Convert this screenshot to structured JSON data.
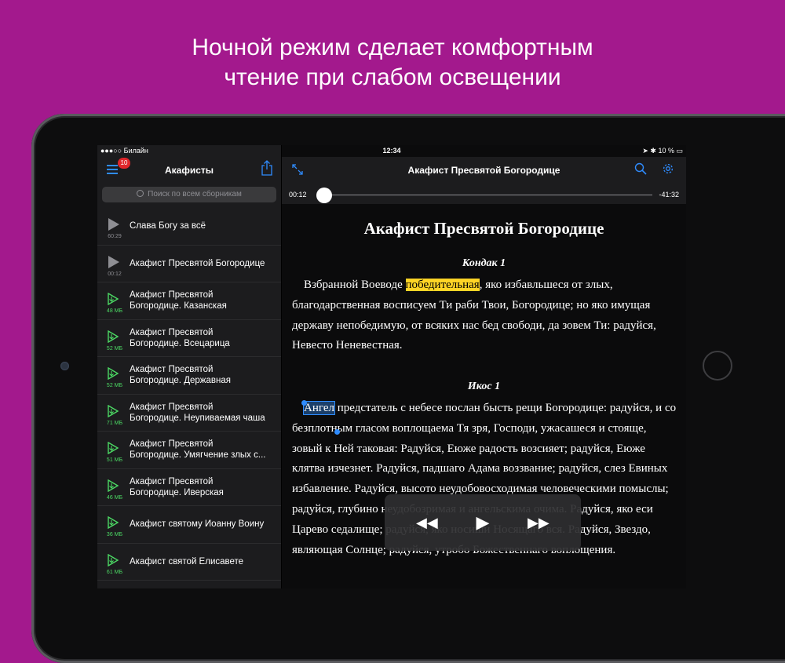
{
  "headline": {
    "line1": "Ночной режим сделает комфортным",
    "line2": "чтение при слабом освещении"
  },
  "colors": {
    "background": "#a3198d",
    "accent": "#2f8cff",
    "highlight": "#ffd426",
    "downloaded_green": "#4cd964",
    "badge_red": "#e0262b"
  },
  "status_bar": {
    "carrier": "●●●○○ Билайн",
    "time": "12:34",
    "battery": "10 %"
  },
  "sidebar": {
    "title": "Акафисты",
    "badge": "10",
    "search_placeholder": "Поиск по всем сборникам",
    "items": [
      {
        "title": "Слава Богу за всё",
        "meta": "60:29",
        "icon": "play-gray-icon"
      },
      {
        "title": "Акафист Пресвятой Богородице",
        "meta": "00:12",
        "icon": "play-gray-icon"
      },
      {
        "title": "Акафист Пресвятой\nБогородице. Казанская",
        "meta": "48 МБ",
        "icon": "download-play-green-icon"
      },
      {
        "title": "Акафист Пресвятой\nБогородице. Всецарица",
        "meta": "52 МБ",
        "icon": "download-play-green-icon"
      },
      {
        "title": "Акафист Пресвятой\nБогородице. Державная",
        "meta": "52 МБ",
        "icon": "download-play-green-icon"
      },
      {
        "title": "Акафист Пресвятой\nБогородице. Неупиваемая чаша",
        "meta": "71 МБ",
        "icon": "download-play-green-icon"
      },
      {
        "title": "Акафист Пресвятой\nБогородице. Умягчение злых с...",
        "meta": "51 МБ",
        "icon": "download-play-green-icon"
      },
      {
        "title": "Акафист Пресвятой\nБогородице. Иверская",
        "meta": "46 МБ",
        "icon": "download-play-green-icon"
      },
      {
        "title": "Акафист святому Иоанну Воину",
        "meta": "36 МБ",
        "icon": "download-play-green-icon"
      },
      {
        "title": "Акафист святой Елисавете",
        "meta": "61 МБ",
        "icon": "download-play-green-icon"
      }
    ]
  },
  "main": {
    "nav_title": "Акафист Пресвятой Богородице",
    "elapsed": "00:12",
    "remaining": "-41:32",
    "progress_fraction": 0.005,
    "doc": {
      "title": "Акафист Пресвятой Богородице",
      "kondak_heading": "Кондак 1",
      "kondak_before": "Взбранной Воеводе ",
      "kondak_highlight": "победительная",
      "kondak_after": ", яко избавльшеся от злых, благодарственная восписуем Ти раби Твои, Богородице; но яко имущая державу непобедимую, от всяких нас бед свободи, да зовем Ти: радуйся, Невесто Неневестная.",
      "ikos_heading": "Икос 1",
      "ikos_selected": "Ангел",
      "ikos_after": " предстатель с небесе послан бысть рещи Богородице: радуйся, и со безплотным гласом воплощаема Тя зря, Господи, ужасашеся и стояще, зовый к Ней таковая: Радуйся, Еюже радость возсияет; радуйся, Еюже клятва изчезнет. Радуйся, падшаго Адама воззвание; радуйся, слез Евиных избавление. Радуйся, высото неудобовосходимая человеческими помыслы; радуйся, глубино неудобозримая и ангельскима очима. Радуйся, яко еси Царево седалище; радуйся, яко носиши Носящаго вся. Радуйся, Звездо, являющая Солнце; радуйся, утробо Божественнаго воплощения."
    }
  }
}
